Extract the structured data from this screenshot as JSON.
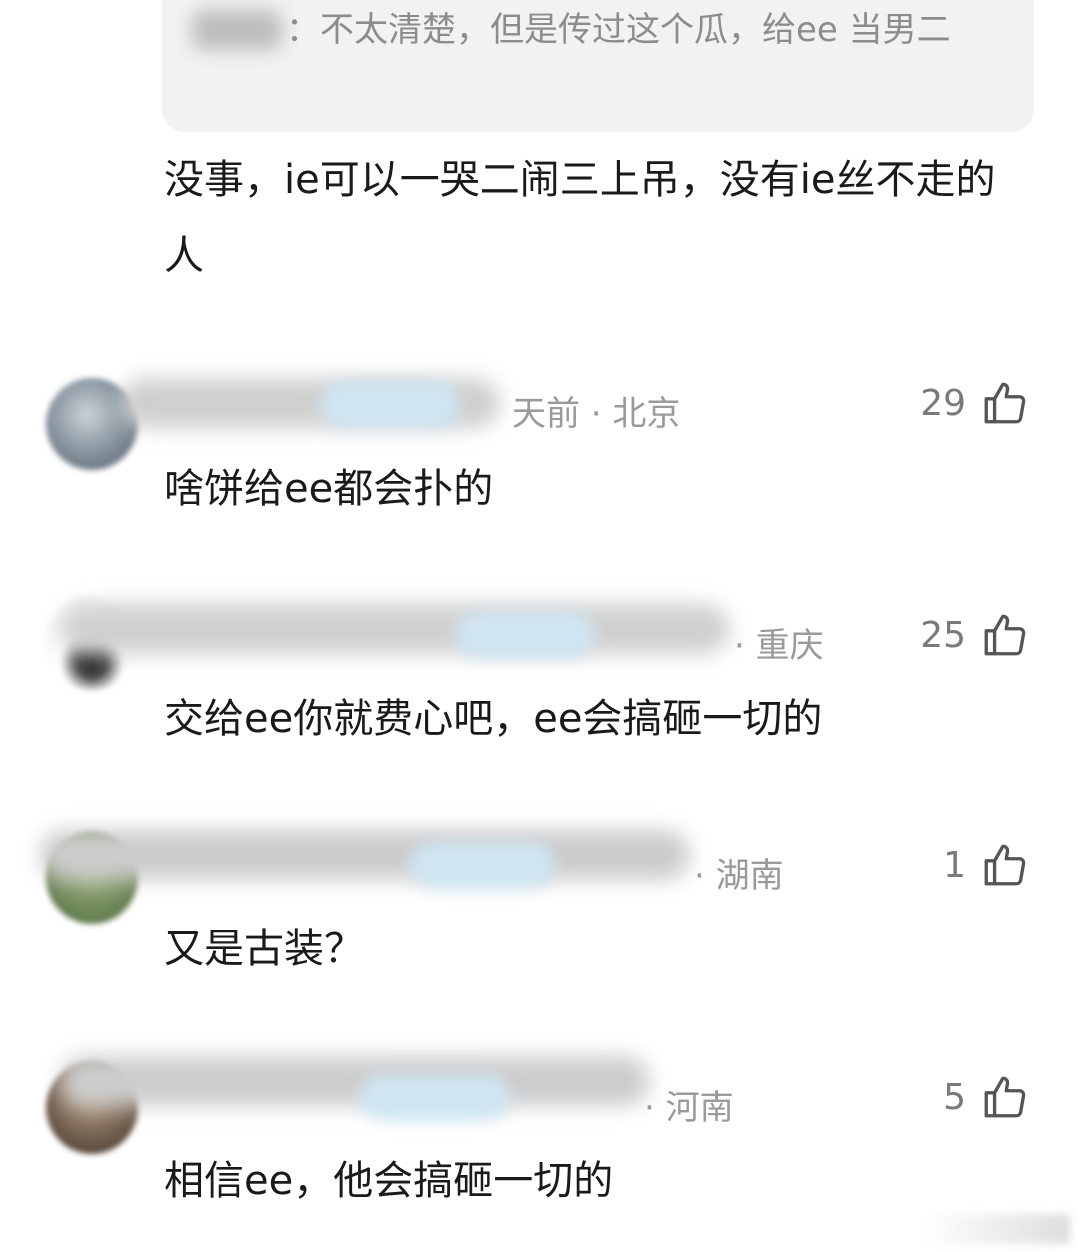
{
  "quote": {
    "text": "：不太清楚，但是传过这个瓜，给ee 当男二"
  },
  "lead_comment": {
    "body": "没事，ie可以一哭二闹三上吊，没有ie丝不走的人"
  },
  "comments": [
    {
      "meta": "天前 · 北京",
      "likes": "29",
      "text": "啥饼给ee都会扑的",
      "avatar_colors": [
        "#6f7b86",
        "#c9d3da"
      ]
    },
    {
      "meta": "· 重庆",
      "likes": "25",
      "text": "交给ee你就费心吧，ee会搞砸一切的",
      "avatar_colors": [
        "#ffffff",
        "#222222"
      ]
    },
    {
      "meta": "· 湖南",
      "likes": "1",
      "text": "又是古装？",
      "avatar_colors": [
        "#6b8a55",
        "#a7b98d"
      ]
    },
    {
      "meta": "· 河南",
      "likes": "5",
      "text": "相信ee，他会搞砸一切的",
      "avatar_colors": [
        "#5c4a3c",
        "#b8a48c"
      ]
    }
  ],
  "icons": {
    "like": "thumbs-up-outline"
  },
  "colors": {
    "meta_gray": "#9a9a9a",
    "quote_bg": "#f2f2f2",
    "badge_blue": "#cfe6f3"
  }
}
